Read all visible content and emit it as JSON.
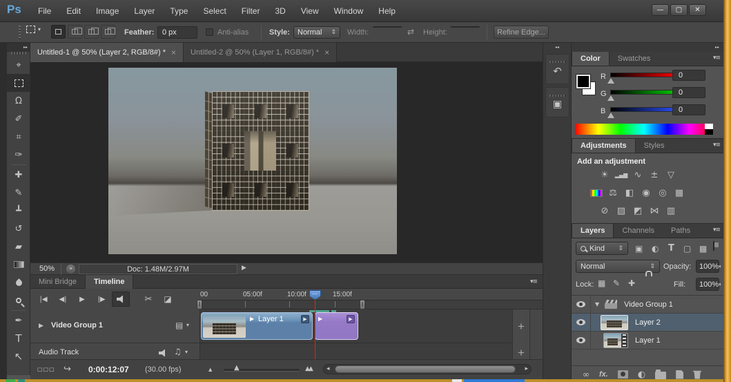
{
  "titlebar": {
    "logo": "Ps",
    "menus": [
      "File",
      "Edit",
      "Image",
      "Layer",
      "Type",
      "Select",
      "Filter",
      "3D",
      "View",
      "Window",
      "Help"
    ]
  },
  "window_controls": {
    "minimize": "—",
    "maximize": "▢",
    "close": "✕"
  },
  "options_bar": {
    "feather_label": "Feather:",
    "feather_value": "0 px",
    "antialias_label": "Anti-alias",
    "style_label": "Style:",
    "style_value": "Normal",
    "width_label": "Width:",
    "width_value": "",
    "height_label": "Height:",
    "height_value": "",
    "refine_edge_label": "Refine Edge..."
  },
  "document_tabs": [
    {
      "title": "Untitled-1 @ 50% (Layer 2, RGB/8#) *"
    },
    {
      "title": "Untitled-2 @ 50% (Layer 1, RGB/8#) *"
    }
  ],
  "status_bar": {
    "zoom_value": "50%",
    "doc_info": "Doc: 1.48M/2.97M"
  },
  "timeline": {
    "tabs": [
      "Mini Bridge",
      "Timeline"
    ],
    "ruler_labels": [
      "00",
      "05:00f",
      "10:00f",
      "15:00f"
    ],
    "video_group_label": "Video Group 1",
    "audio_track_label": "Audio Track",
    "clip1_label": "Layer 1",
    "timecode": "0:00:12:07",
    "framerate": "(30.00 fps)"
  },
  "color_panel": {
    "tabs": [
      "Color",
      "Swatches"
    ],
    "channels": [
      {
        "label": "R",
        "value": "0"
      },
      {
        "label": "G",
        "value": "0"
      },
      {
        "label": "B",
        "value": "0"
      }
    ]
  },
  "adjustments_panel": {
    "tabs": [
      "Adjustments",
      "Styles"
    ],
    "heading": "Add an adjustment"
  },
  "layers_panel": {
    "tabs": [
      "Layers",
      "Channels",
      "Paths"
    ],
    "filter_value": "Kind",
    "blend_mode": "Normal",
    "opacity_label": "Opacity:",
    "opacity_value": "100%",
    "lock_label": "Lock:",
    "fill_label": "Fill:",
    "fill_value": "100%",
    "fx_label": "fx.",
    "layers": [
      {
        "name": "Video Group 1"
      },
      {
        "name": "Layer 2"
      },
      {
        "name": "Layer 1"
      }
    ]
  },
  "colors": {
    "video_clip_blue": "#5d80a8",
    "audio_clip_purple": "#9177c4",
    "selected_layer_row": "#50606e",
    "playhead_red": "#d8281e",
    "window_border_orange": "#e8a338",
    "logo_blue": "#64a8dc"
  },
  "icons": {
    "collapse_right": "▸▸",
    "collapse_left": "◂◂",
    "panel_menu": "▾≡",
    "tab_close": "×",
    "combo_arrows": "⇕",
    "dropdown_arrow": "▾",
    "swap_arrows": "⇄",
    "go_first": "|◀",
    "prev_frame": "◀|",
    "play": "▶",
    "next_frame": "|▶",
    "scissors": "✂",
    "transition": "◪",
    "disclosure_right": "▶",
    "disclosure_down": "▼",
    "film_frame": "▤",
    "music_note": "♫",
    "plus": "+",
    "render_squares": "▢▢▢",
    "export_arrow": "↪",
    "zoom_out": "▲",
    "zoom_in": "▲▲",
    "scroll_left": "◂",
    "scroll_right": "▸",
    "status_arrow": "▶",
    "work_area_grip": "∥",
    "playhead_dots": "⋯",
    "tools": {
      "move": "⌖",
      "lasso": "Ω",
      "quick_select": "✐",
      "crop": "⌗",
      "eyedropper": "✑",
      "healing": "✚",
      "brush": "✎",
      "stamp": "┻",
      "history": "↺",
      "eraser": "▰",
      "type": "T",
      "path_select": "↖",
      "pen": "✒"
    },
    "history_panel": "↶",
    "threed_panel": "▣",
    "adjustments": [
      "☀",
      "▂▄▆",
      "∿",
      "±",
      "▽",
      "",
      "⚖",
      "◧",
      "◉",
      "◎",
      "▦",
      "⊘",
      "▨",
      "◩",
      "⋈",
      "▥"
    ],
    "layer_filters": [
      "▣",
      "◐",
      "T",
      "▢",
      "▩"
    ],
    "locks": [
      "▦",
      "✎",
      "✚"
    ]
  }
}
